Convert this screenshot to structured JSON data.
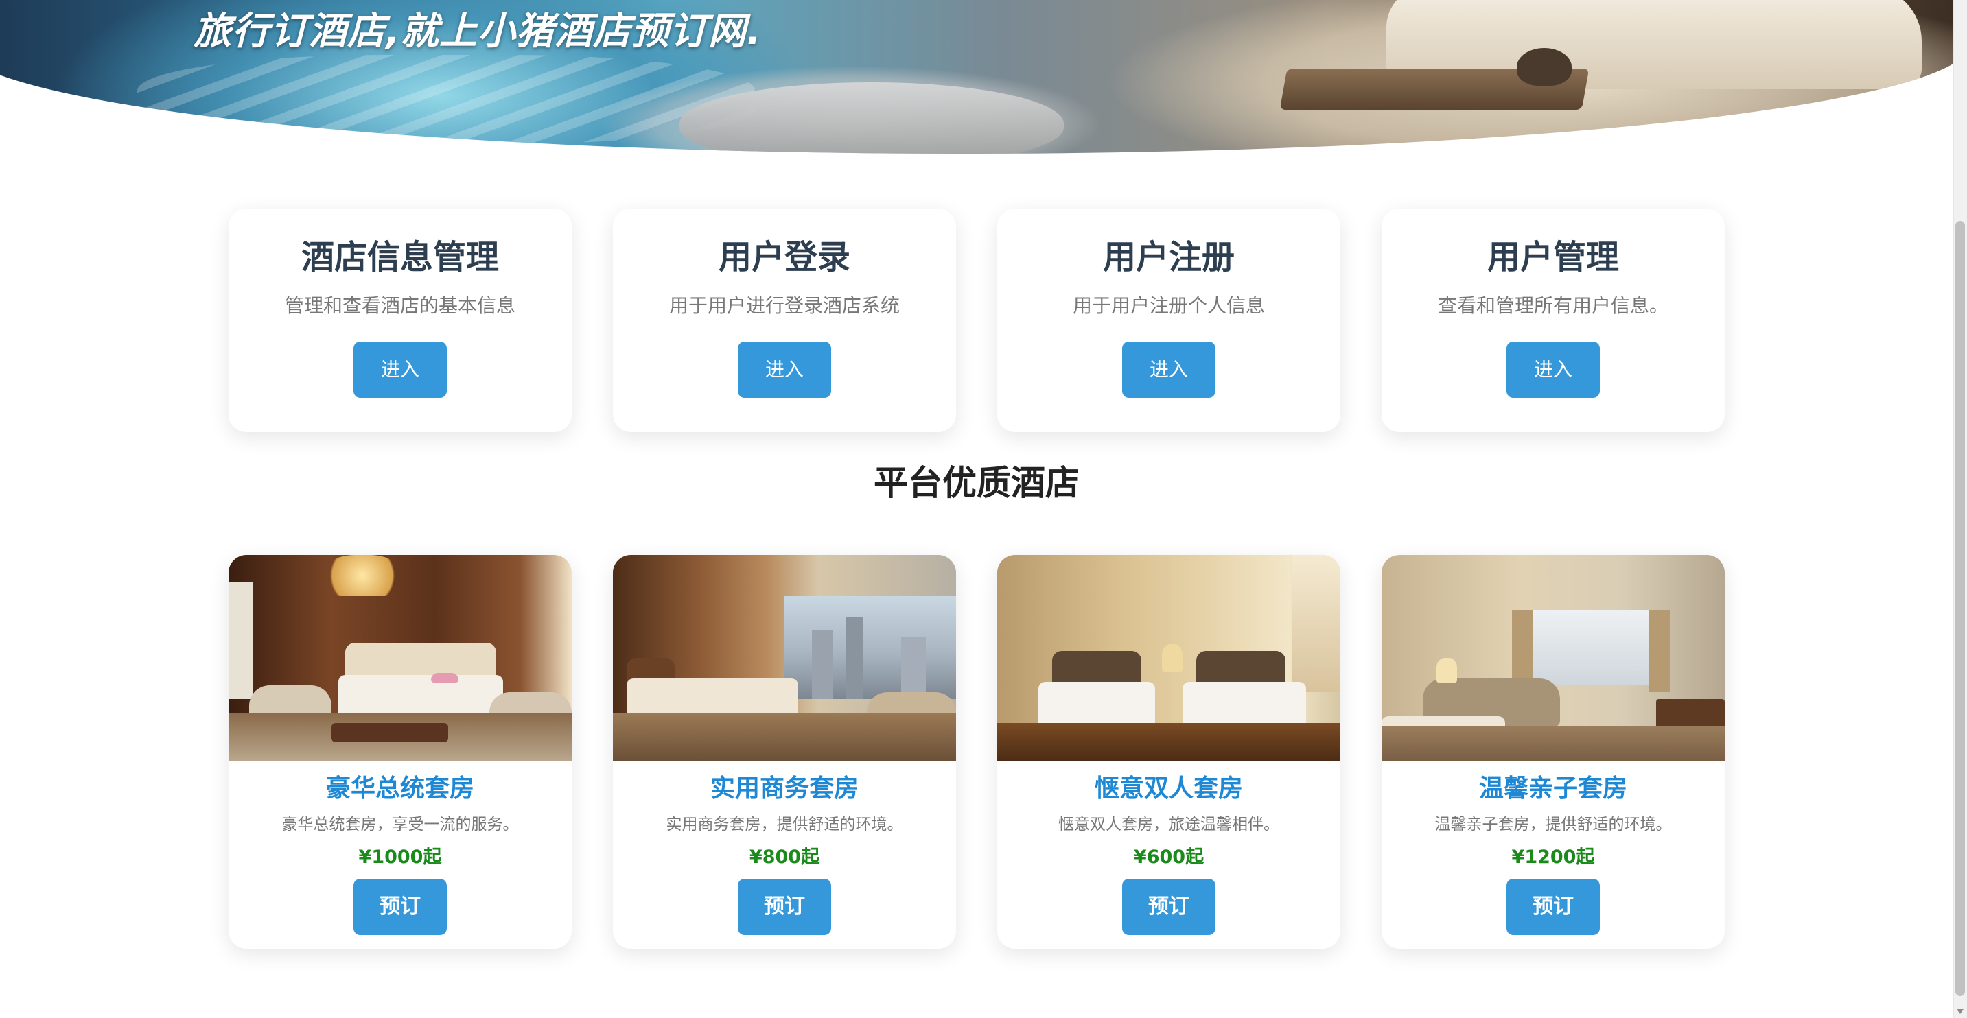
{
  "hero": {
    "title": "旅行订酒店,就上小猪酒店预订网."
  },
  "features": [
    {
      "title": "酒店信息管理",
      "desc": "管理和查看酒店的基本信息",
      "button": "进入"
    },
    {
      "title": "用户登录",
      "desc": "用于用户进行登录酒店系统",
      "button": "进入"
    },
    {
      "title": "用户注册",
      "desc": "用于用户注册个人信息",
      "button": "进入"
    },
    {
      "title": "用户管理",
      "desc": "查看和管理所有用户信息。",
      "button": "进入"
    }
  ],
  "hotels_section": {
    "title": "平台优质酒店"
  },
  "hotels": [
    {
      "name": "豪华总统套房",
      "desc": "豪华总统套房，享受一流的服务。",
      "price": "¥1000起",
      "button": "预订"
    },
    {
      "name": "实用商务套房",
      "desc": "实用商务套房，提供舒适的环境。",
      "price": "¥800起",
      "button": "预订"
    },
    {
      "name": "惬意双人套房",
      "desc": "惬意双人套房，旅途温馨相伴。",
      "price": "¥600起",
      "button": "预订"
    },
    {
      "name": "温馨亲子套房",
      "desc": "温馨亲子套房，提供舒适的环境。",
      "price": "¥1200起",
      "button": "预订"
    }
  ],
  "colors": {
    "primary_button": "#3498db",
    "hotel_name": "#1e88d4",
    "price": "#1a8a1a",
    "heading": "#2c3e50"
  }
}
